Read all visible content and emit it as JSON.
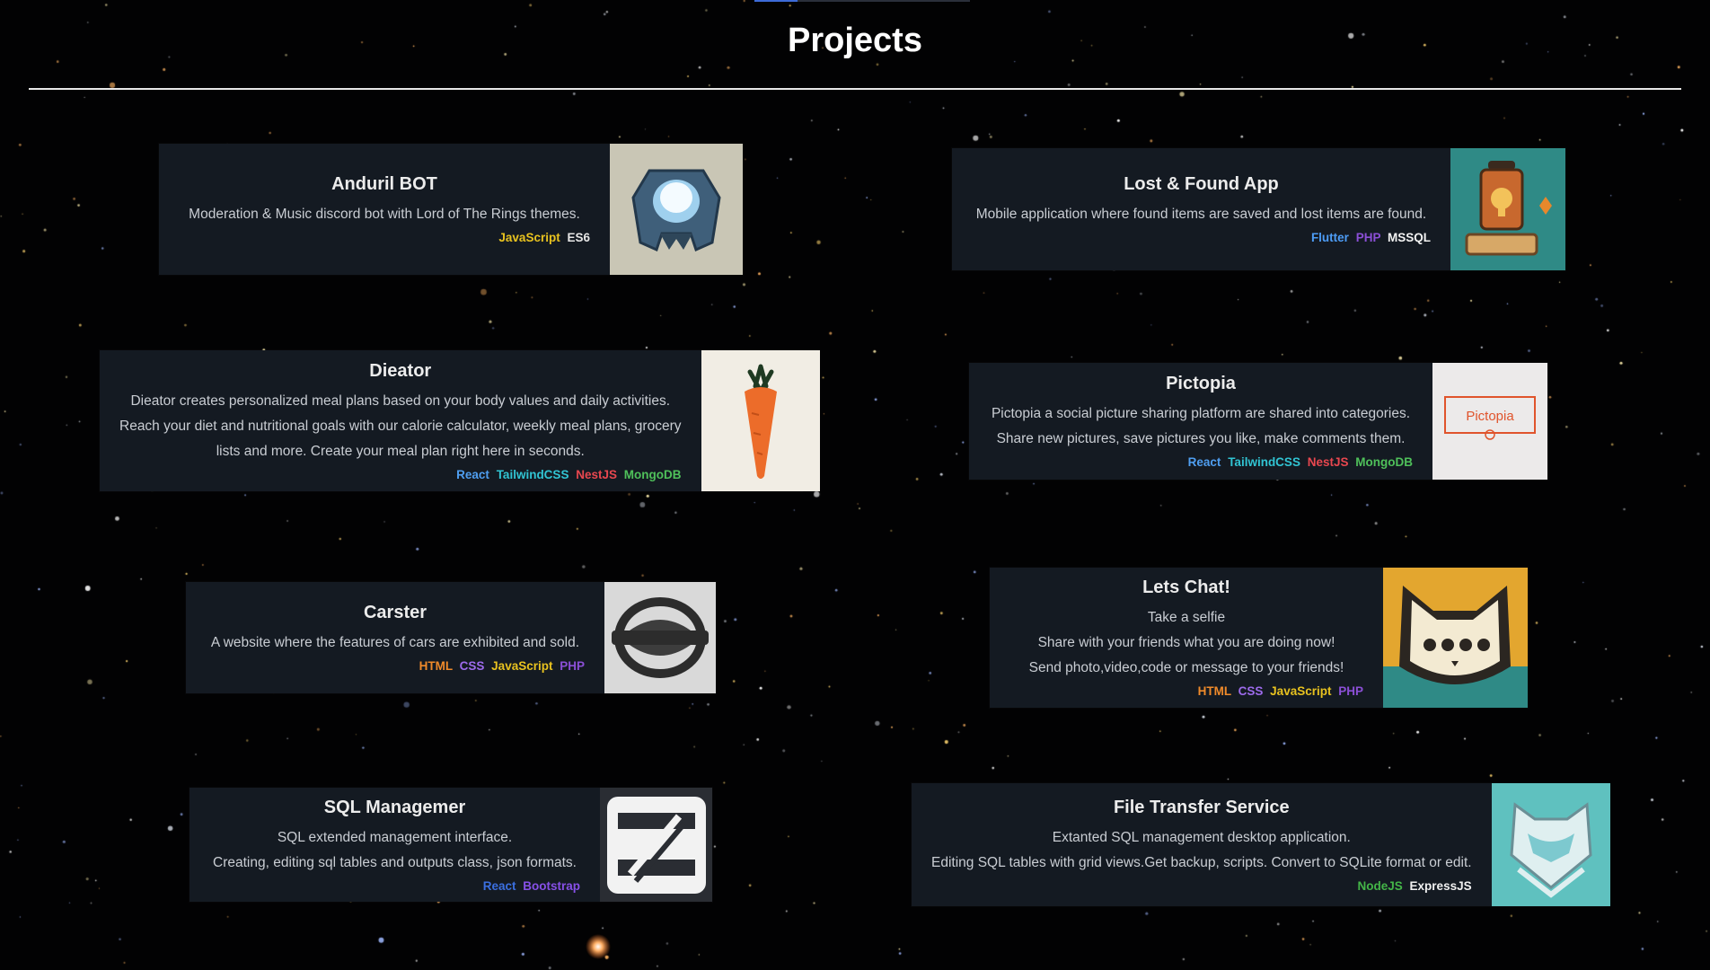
{
  "page": {
    "title": "Projects"
  },
  "projects": [
    {
      "title": "Anduril BOT",
      "desc": [
        "Moderation & Music discord bot with Lord of The Rings themes."
      ],
      "tags": [
        "JavaScript",
        "ES6"
      ],
      "image_icon": "robot-helmet-logo",
      "image_bg": "#c9c6b5"
    },
    {
      "title": "Lost & Found App",
      "desc": [
        "Mobile application where found items are saved and lost items are found."
      ],
      "tags": [
        "Flutter",
        "PHP",
        "MSSQL"
      ],
      "image_icon": "lantern-box-logo",
      "image_bg": "#2f8a86"
    },
    {
      "title": "Dieator",
      "desc": [
        "Dieator creates personalized meal plans based on your body values and daily activities.",
        "Reach your diet and nutritional goals with our calorie calculator, weekly meal plans, grocery",
        "lists and more. Create your meal plan right here in seconds."
      ],
      "tags": [
        "React",
        "TailwindCSS",
        "NestJS",
        "MongoDB"
      ],
      "image_icon": "carrot-logo",
      "image_bg": "#f1ede4"
    },
    {
      "title": "Pictopia",
      "desc": [
        "Pictopia a social picture sharing platform are shared into categories.",
        "Share new pictures, save pictures you like, make comments them."
      ],
      "tags": [
        "React",
        "TailwindCSS",
        "NestJS",
        "MongoDB"
      ],
      "image_icon": "pictopia-logo",
      "image_text": "Pictopia",
      "image_bg": "#eceaea"
    },
    {
      "title": "Carster",
      "desc": [
        "A website where the features of cars are exhibited and sold."
      ],
      "tags": [
        "HTML",
        "CSS",
        "JavaScript",
        "PHP"
      ],
      "image_icon": "car-emblem-logo",
      "image_bg": "#d9d9d9"
    },
    {
      "title": "Lets Chat!",
      "desc": [
        "Take a selfie",
        "Share with your friends what you are doing now!",
        "Send photo,video,code or message to your friends!"
      ],
      "tags": [
        "HTML",
        "CSS",
        "JavaScript",
        "PHP"
      ],
      "image_icon": "cat-chat-logo",
      "image_bg": "#e3a62f"
    },
    {
      "title": "SQL Managemer",
      "desc": [
        "SQL extended management interface.",
        "Creating, editing sql tables and outputs class, json formats."
      ],
      "tags": [
        "React",
        "Bootstrap"
      ],
      "image_icon": "slash-box-logo",
      "image_bg": "#2a2d33"
    },
    {
      "title": "File Transfer Service",
      "desc": [
        "Extanted SQL management desktop application.",
        "Editing SQL tables with grid views.Get backup, scripts. Convert to SQLite format or edit."
      ],
      "tags": [
        "NodeJS",
        "ExpressJS"
      ],
      "image_icon": "fox-shield-logo",
      "image_bg": "#5fc1bf"
    }
  ]
}
